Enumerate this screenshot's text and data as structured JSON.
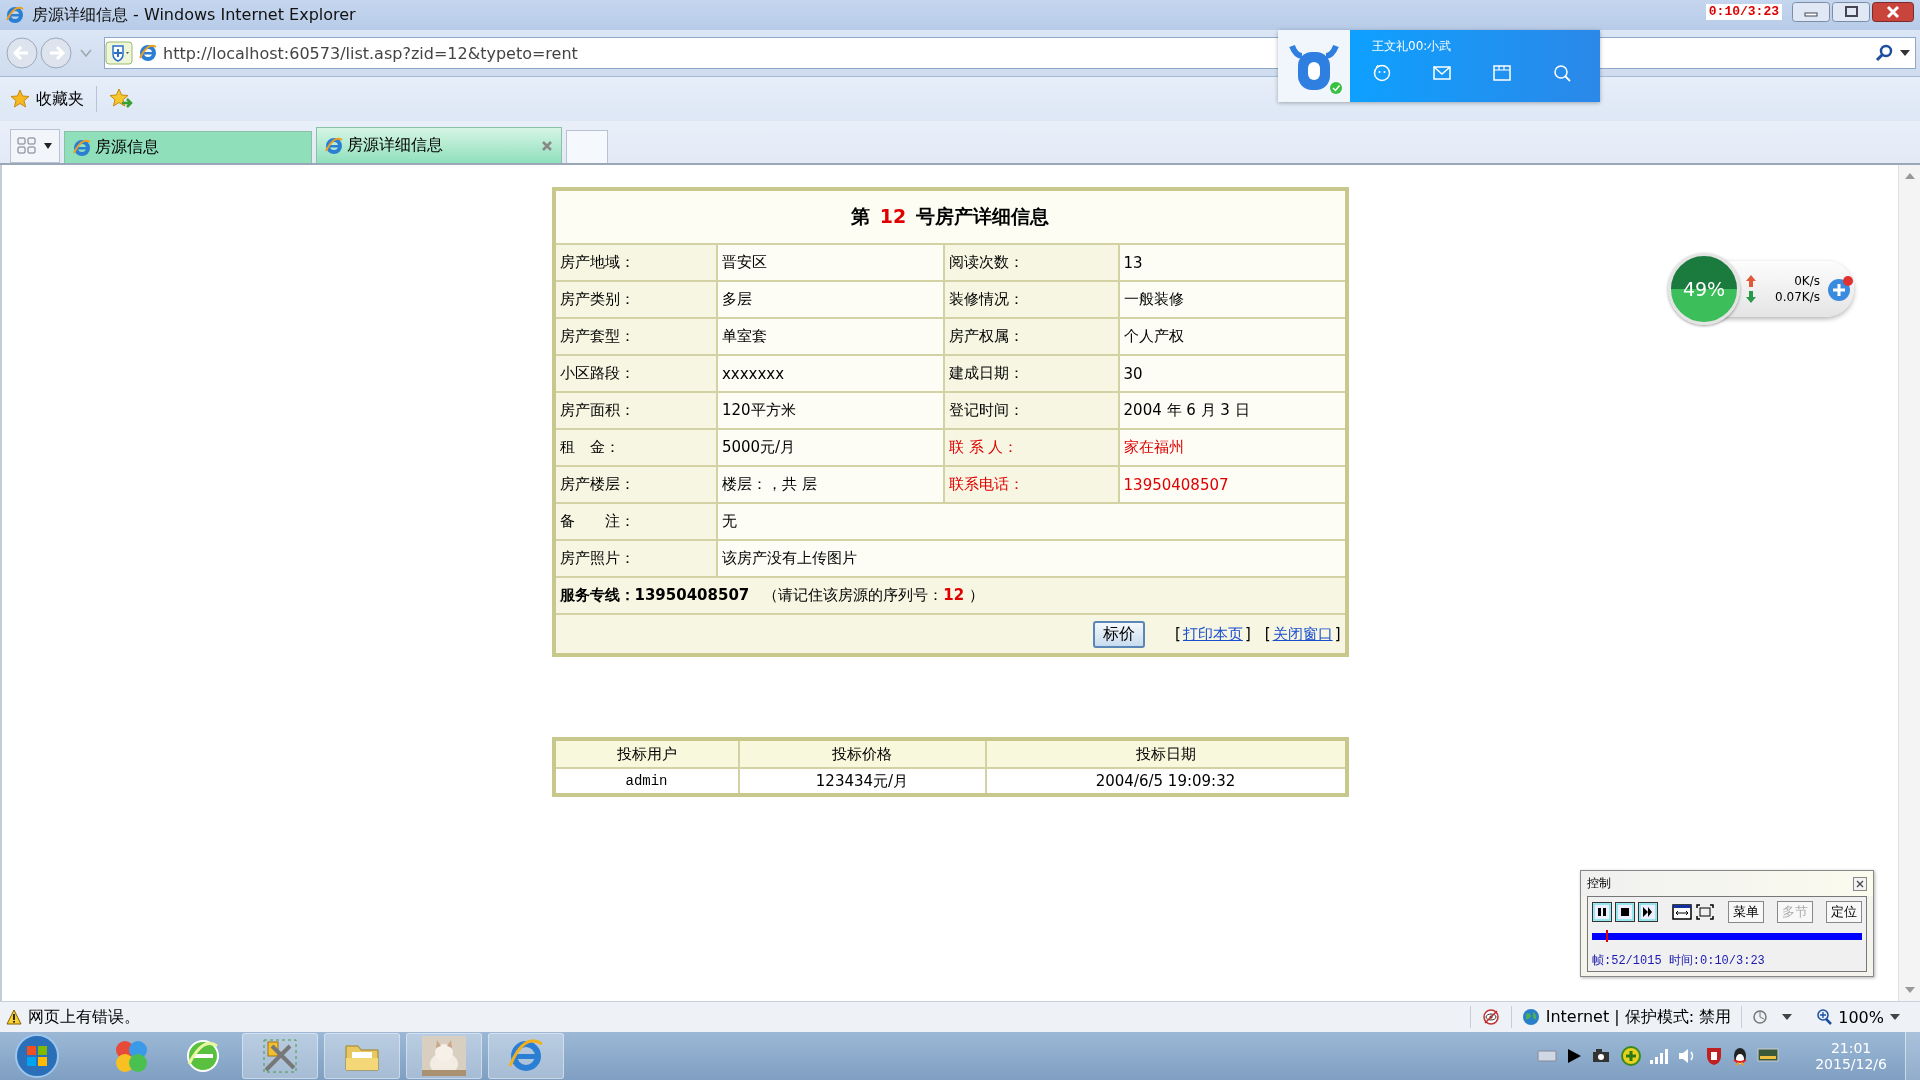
{
  "window": {
    "title": "房源详细信息 - Windows Internet Explorer",
    "recorder_time": "0:10/3:23"
  },
  "address_bar": {
    "url": "http://localhost:60573/list.asp?zid=12&typeto=rent"
  },
  "favorites_bar": {
    "label": "收藏夹"
  },
  "tabs": [
    {
      "label": "房源信息",
      "selected": false
    },
    {
      "label": "房源详细信息",
      "selected": true
    }
  ],
  "qq_popup": {
    "name": "王文礼00:小武"
  },
  "detail": {
    "title_prefix": "第",
    "number": "12",
    "title_suffix": "号房产详细信息",
    "rows": [
      {
        "cells": [
          {
            "label": "房产地域：",
            "value": "晋安区",
            "highlight": false
          },
          {
            "label": "阅读次数：",
            "value": "13",
            "highlight": false
          }
        ]
      },
      {
        "cells": [
          {
            "label": "房产类别：",
            "value": "多层",
            "highlight": false
          },
          {
            "label": "装修情况：",
            "value": "一般装修",
            "highlight": false
          }
        ]
      },
      {
        "cells": [
          {
            "label": "房产套型：",
            "value": "单室套",
            "highlight": false
          },
          {
            "label": "房产权属：",
            "value": "个人产权",
            "highlight": false
          }
        ]
      },
      {
        "cells": [
          {
            "label": "小区路段：",
            "value": "xxxxxxx",
            "highlight": false
          },
          {
            "label": "建成日期：",
            "value": "30",
            "highlight": false
          }
        ]
      },
      {
        "cells": [
          {
            "label": "房产面积：",
            "value": "120平方米",
            "highlight": false
          },
          {
            "label": "登记时间：",
            "value": "2004 年 6 月 3 日",
            "highlight": false
          }
        ]
      },
      {
        "cells": [
          {
            "label": "租　金：",
            "value": "5000元/月",
            "highlight": false
          },
          {
            "label": "联 系 人：",
            "value": "家在福州",
            "highlight": true
          }
        ]
      },
      {
        "cells": [
          {
            "label": "房产楼层：",
            "value": "楼层：，共 层",
            "highlight": false
          },
          {
            "label": "联系电话：",
            "value": "13950408507",
            "highlight": true
          }
        ]
      },
      {
        "cells": [
          {
            "label": "备　　注：",
            "value": "无",
            "highlight": false
          }
        ]
      },
      {
        "cells": [
          {
            "label": "房产照片：",
            "value": "该房产没有上传图片",
            "highlight": false
          }
        ]
      }
    ],
    "service_line": {
      "label": "服务专线：13950408507",
      "note_prefix": "（请记住该房源的序列号：",
      "serial": "12",
      "note_suffix": "）"
    },
    "bid_button": "标价",
    "links": [
      {
        "open": "[",
        "label": "打印本页",
        "close": "]"
      },
      {
        "open": "[",
        "label": "关闭窗口",
        "close": "]"
      }
    ]
  },
  "bids": {
    "columns": [
      "投标用户",
      "投标价格",
      "投标日期"
    ],
    "rows": [
      [
        "admin",
        "123434元/月",
        "2004/6/5 19:09:32"
      ]
    ]
  },
  "net_monitor": {
    "percent": "49%",
    "upload": "0K/s",
    "download": "0.07K/s"
  },
  "player_control": {
    "title": "控制",
    "buttons": [
      {
        "label": "菜单",
        "disabled": false
      },
      {
        "label": "多节",
        "disabled": true
      },
      {
        "label": "定位",
        "disabled": false
      }
    ],
    "level": 0.05,
    "info": "帧:52/1015 时间:0:10/3:23"
  },
  "status_bar": {
    "message": "网页上有错误。",
    "zone": "Internet | 保护模式: 禁用",
    "zoom": "100%"
  },
  "taskbar": {
    "time": "21:01",
    "date": "2015/12/6"
  }
}
